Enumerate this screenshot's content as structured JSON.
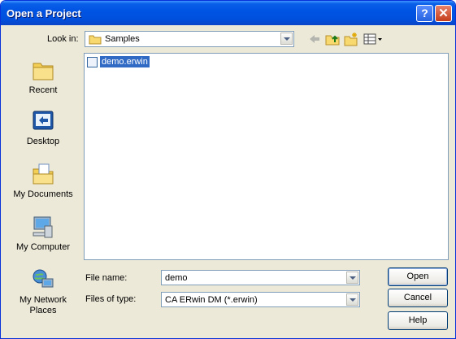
{
  "window": {
    "title": "Open a Project"
  },
  "titlebar": {
    "help_glyph": "?",
    "close_glyph": "✕"
  },
  "lookin": {
    "label": "Look in:",
    "value": "Samples",
    "icon": "folder-icon"
  },
  "toolbar": {
    "icons": [
      "back-arrow-icon",
      "up-one-level-icon",
      "new-folder-icon",
      "view-menu-icon"
    ]
  },
  "places": [
    {
      "label": "Recent",
      "icon": "recent-icon"
    },
    {
      "label": "Desktop",
      "icon": "desktop-icon"
    },
    {
      "label": "My Documents",
      "icon": "my-documents-icon"
    },
    {
      "label": "My Computer",
      "icon": "my-computer-icon"
    },
    {
      "label": "My Network Places",
      "icon": "network-places-icon"
    }
  ],
  "files": [
    {
      "name": "demo.erwin",
      "icon": "erwin-file-icon",
      "selected": true
    }
  ],
  "filename": {
    "label": "File name:",
    "value": "demo"
  },
  "filetype": {
    "label": "Files of type:",
    "value": "CA ERwin DM (*.erwin)"
  },
  "buttons": {
    "open": "Open",
    "cancel": "Cancel",
    "help": "Help"
  },
  "colors": {
    "titlebar": "#0054e3",
    "selection": "#316ac5",
    "dialog_bg": "#ece9d8"
  }
}
